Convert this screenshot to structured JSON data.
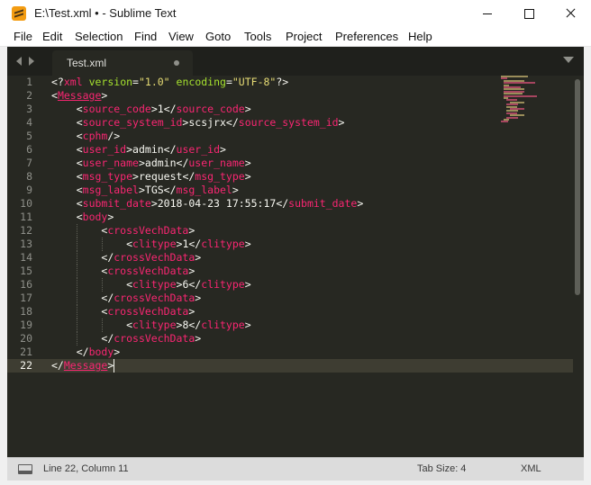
{
  "window": {
    "title": "E:\\Test.xml • - Sublime Text",
    "icon": "sublime-text-icon",
    "controls": [
      "minimize",
      "maximize",
      "close"
    ]
  },
  "menu": [
    "File",
    "Edit",
    "Selection",
    "Find",
    "View",
    "Goto",
    "Tools",
    "Project",
    "Preferences",
    "Help"
  ],
  "tab": {
    "label": "Test.xml",
    "dirty": true
  },
  "editor": {
    "theme_colors": {
      "background": "#272822",
      "tag": "#f92672",
      "attribute": "#a6e22e",
      "string": "#e6db74",
      "text": "#f8f8f2",
      "gutter": "#8f908a",
      "line_highlight": "#3e3d32"
    },
    "line_numbers": [
      "1",
      "2",
      "3",
      "4",
      "5",
      "6",
      "7",
      "8",
      "9",
      "10",
      "11",
      "12",
      "13",
      "14",
      "15",
      "16",
      "17",
      "18",
      "19",
      "20",
      "21",
      "22"
    ],
    "lines": [
      "<?xml version=\"1.0\" encoding=\"UTF-8\"?>",
      "<Message>",
      "    <source_code>1</source_code>",
      "    <source_system_id>scsjrx</source_system_id>",
      "    <cphm/>",
      "    <user_id>admin</user_id>",
      "    <user_name>admin</user_name>",
      "    <msg_type>request</msg_type>",
      "    <msg_label>TGS</msg_label>",
      "    <submit_date>2018-04-23 17:55:17</submit_date>",
      "    <body>",
      "        <crossVechData>",
      "            <clitype>1</clitype>",
      "        </crossVechData>",
      "        <crossVechData>",
      "            <clitype>6</clitype>",
      "        </crossVechData>",
      "        <crossVechData>",
      "            <clitype>8</clitype>",
      "        </crossVechData>",
      "    </body>",
      "</Message>"
    ],
    "active_line": 22
  },
  "status": {
    "position": "Line 22, Column 11",
    "tab_size": "Tab Size: 4",
    "syntax": "XML"
  }
}
